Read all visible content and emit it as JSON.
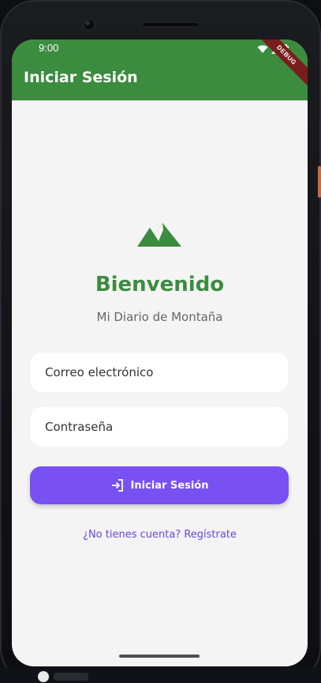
{
  "status": {
    "time": "9:00"
  },
  "appbar": {
    "title": "Iniciar Sesión",
    "debug_label": "DEBUG"
  },
  "hero": {
    "logo_icon": "mountain-icon",
    "welcome": "Bienvenido",
    "subtitle": "Mi Diario de Montaña"
  },
  "form": {
    "email_placeholder": "Correo electrónico",
    "password_placeholder": "Contraseña",
    "login_button": "Iniciar Sesión",
    "login_icon": "login-icon",
    "register_link": "¿No tienes cuenta? Regístrate"
  },
  "colors": {
    "primary_green": "#3b8c3f",
    "accent_purple": "#7950f2",
    "background": "#f4f4f4"
  }
}
